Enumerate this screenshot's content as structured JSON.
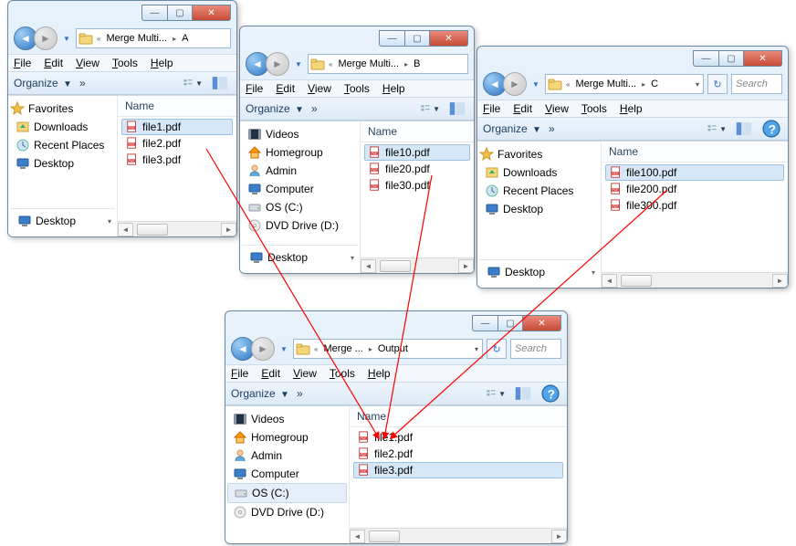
{
  "menubar": {
    "file": "File",
    "edit": "Edit",
    "view": "View",
    "tools": "Tools",
    "help": "Help"
  },
  "toolbar": {
    "organize": "Organize",
    "more": "»"
  },
  "column": {
    "name": "Name"
  },
  "search_placeholder": "Search",
  "windowA": {
    "breadcrumb": [
      "Merge Multi...",
      "A"
    ],
    "nav": {
      "header": "Favorites",
      "items": [
        "Downloads",
        "Recent Places",
        "Desktop"
      ],
      "footer": "Desktop"
    },
    "files": [
      "file1.pdf",
      "file2.pdf",
      "file3.pdf"
    ],
    "selected": 0
  },
  "windowB": {
    "breadcrumb": [
      "Merge Multi...",
      "B"
    ],
    "nav": {
      "items": [
        "Videos",
        "Homegroup",
        "Admin",
        "Computer",
        "OS (C:)",
        "DVD Drive (D:)"
      ],
      "footer": "Desktop"
    },
    "files": [
      "file10.pdf",
      "file20.pdf",
      "file30.pdf"
    ],
    "selected": 0
  },
  "windowC": {
    "breadcrumb": [
      "Merge Multi...",
      "C"
    ],
    "nav": {
      "header": "Favorites",
      "items": [
        "Downloads",
        "Recent Places",
        "Desktop"
      ],
      "footer": "Desktop"
    },
    "files": [
      "file100.pdf",
      "file200.pdf",
      "file300.pdf"
    ],
    "selected": 0
  },
  "windowOut": {
    "breadcrumb": [
      "Merge ...",
      "Output"
    ],
    "nav": {
      "items": [
        "Videos",
        "Homegroup",
        "Admin",
        "Computer",
        "OS (C:)",
        "DVD Drive (D:)"
      ]
    },
    "files": [
      "file1.pdf",
      "file2.pdf",
      "file3.pdf"
    ],
    "selected": 2
  }
}
